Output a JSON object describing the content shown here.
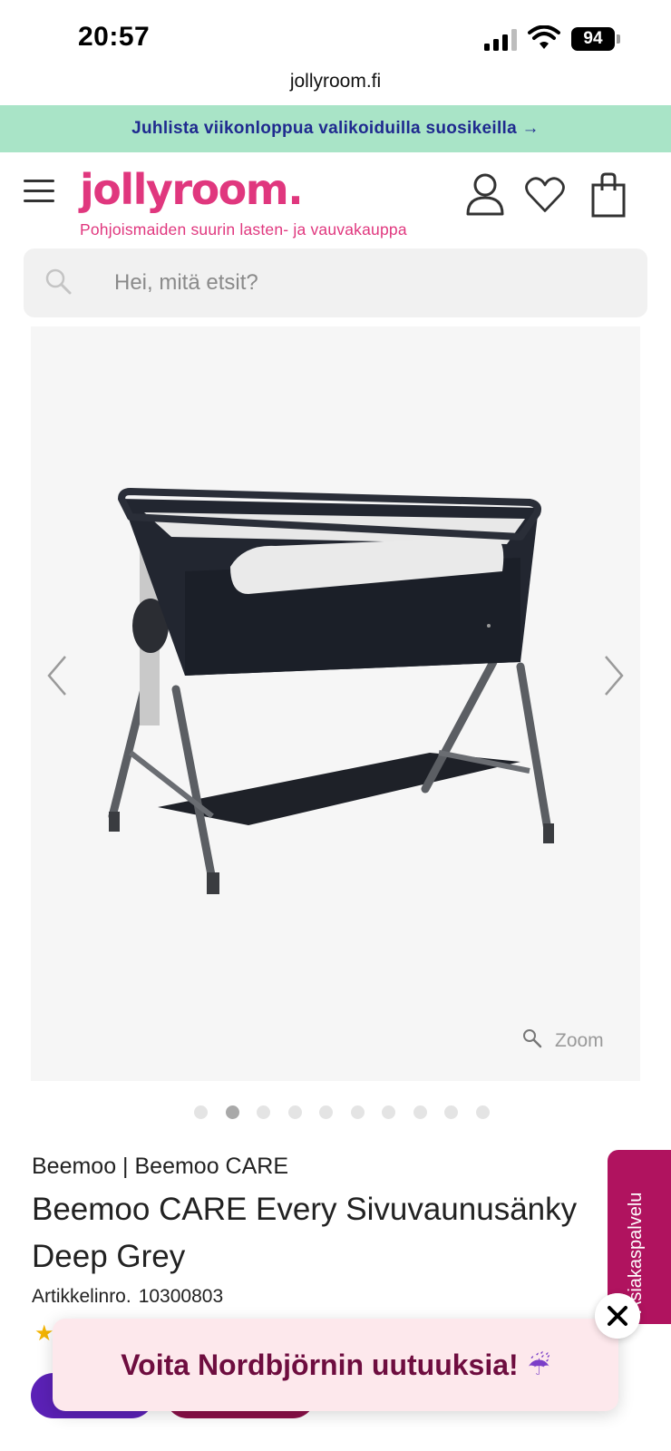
{
  "status_bar": {
    "time": "20:57",
    "battery": "94",
    "icons": [
      "signal-icon",
      "wifi-icon",
      "battery-icon"
    ]
  },
  "browser": {
    "url": "jollyroom.fi"
  },
  "promo": {
    "text": "Juhlista viikonloppua valikoiduilla suosikeilla →"
  },
  "header": {
    "logo": "jollyroom.",
    "tagline": "Pohjoismaiden suurin lasten- ja vauvakauppa",
    "icons": [
      "menu-icon",
      "account-icon",
      "heart-icon",
      "bag-icon"
    ]
  },
  "search": {
    "placeholder": "Hei, mitä etsit?"
  },
  "gallery": {
    "zoom_label": "Zoom",
    "image_count": 10,
    "active_index": 1,
    "icons": [
      "chevron-left-icon",
      "chevron-right-icon",
      "zoom-icon"
    ]
  },
  "product": {
    "brand": "Beemoo | Beemoo CARE",
    "title": "Beemoo CARE Every Sivuvaunusänky Deep Grey",
    "article_label": "Artikkelinro.",
    "article_number": "10300803"
  },
  "side_tab": {
    "label": "Asiakaspalvelu"
  },
  "toast": {
    "text": "Voita Nordbjörnin uutuuksia!",
    "emoji": "☔"
  },
  "colors": {
    "brand_pink": "#e0377e",
    "promo_bg": "#a9e4c7",
    "promo_text": "#1f2a8f",
    "side_tab": "#b0135f",
    "toast_bg": "#fde8ec",
    "toast_text": "#6e0d3f"
  }
}
